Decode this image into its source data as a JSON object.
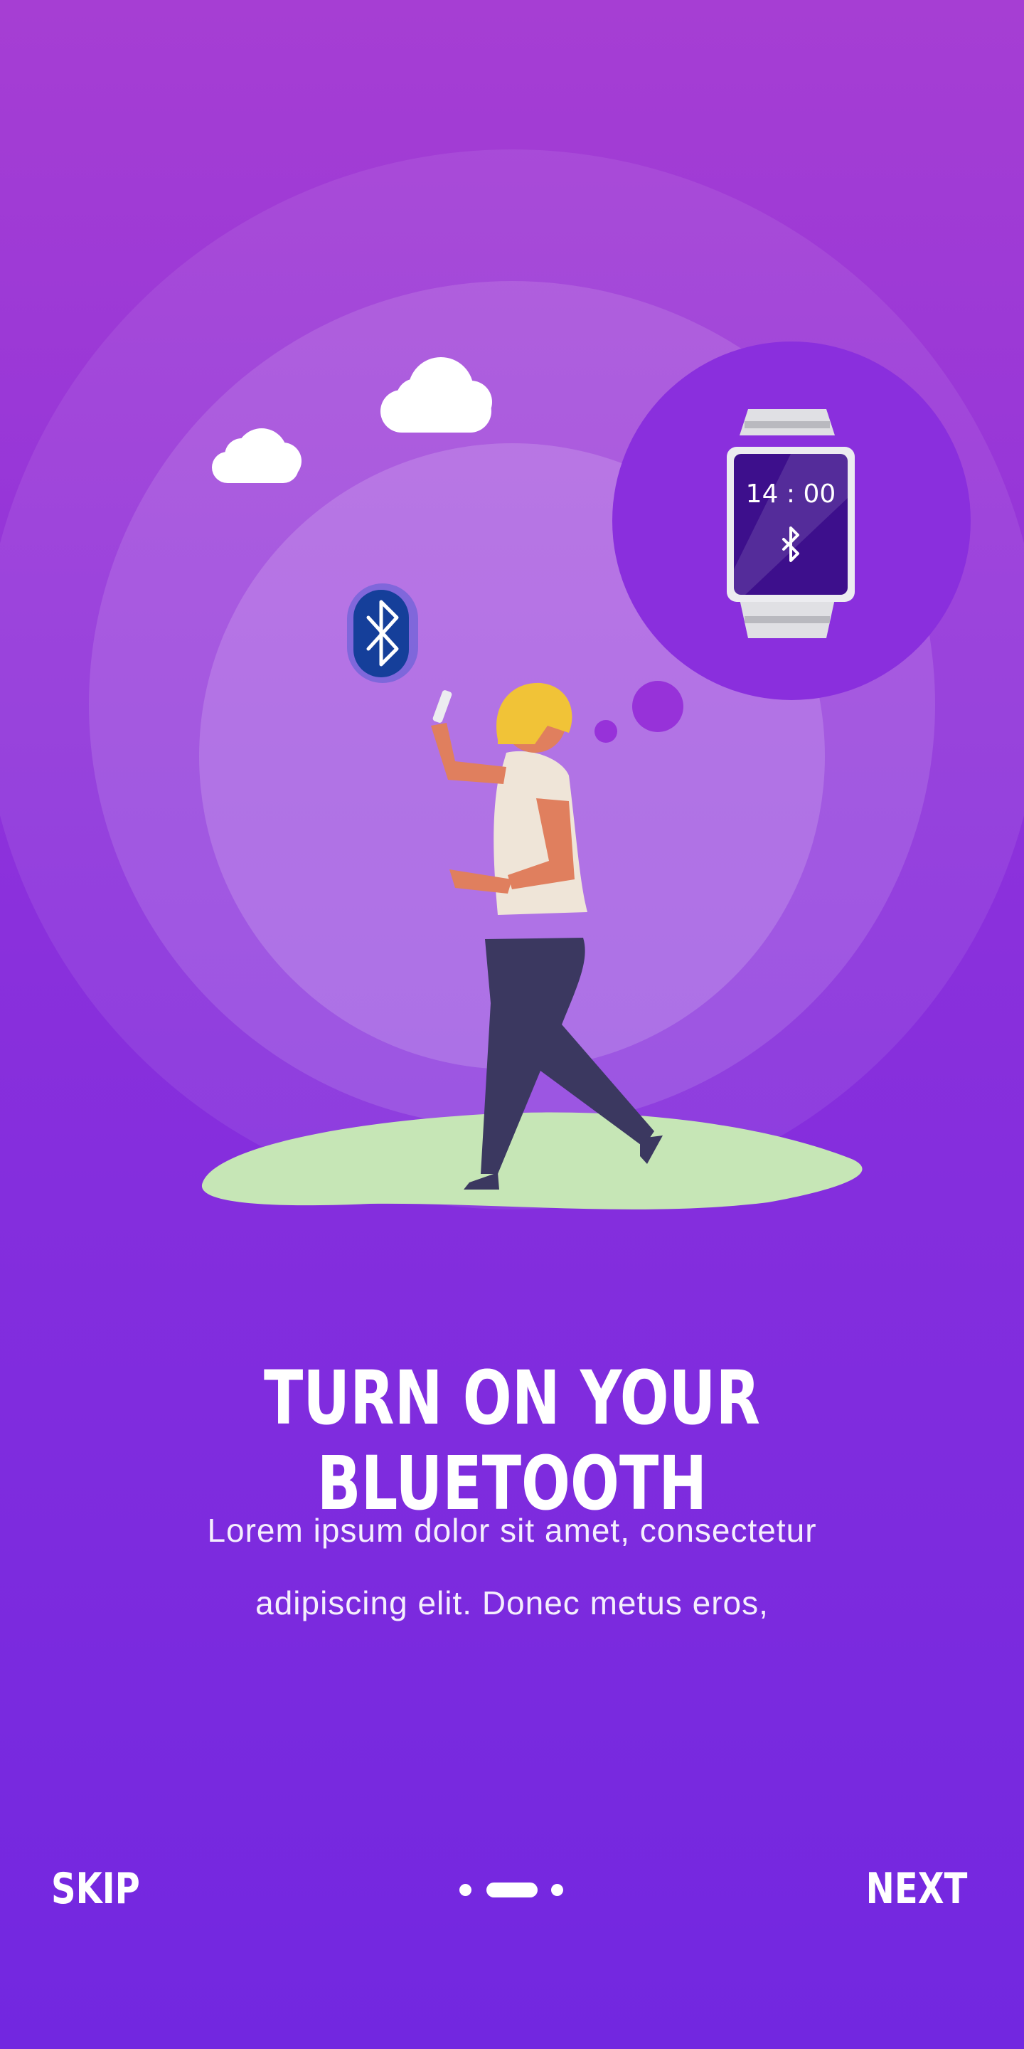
{
  "onboarding": {
    "title": "TURN ON YOUR BLUETOOTH",
    "description_line1": "Lorem ipsum dolor sit amet, consectetur",
    "description_line2": "adipiscing elit. Donec metus eros,",
    "watch_time": "14 : 00"
  },
  "footer": {
    "skip_label": "SKIP",
    "next_label": "NEXT",
    "page_count": 3,
    "active_page": 2
  },
  "colors": {
    "background_top": "#a63ed3",
    "background_bottom": "#7227e0",
    "bluetooth_badge": "#153f9a",
    "ground": "#c6e6b6",
    "hair": "#f1c337"
  },
  "icons": [
    "bluetooth-icon",
    "smartwatch-icon",
    "cloud-icon"
  ]
}
